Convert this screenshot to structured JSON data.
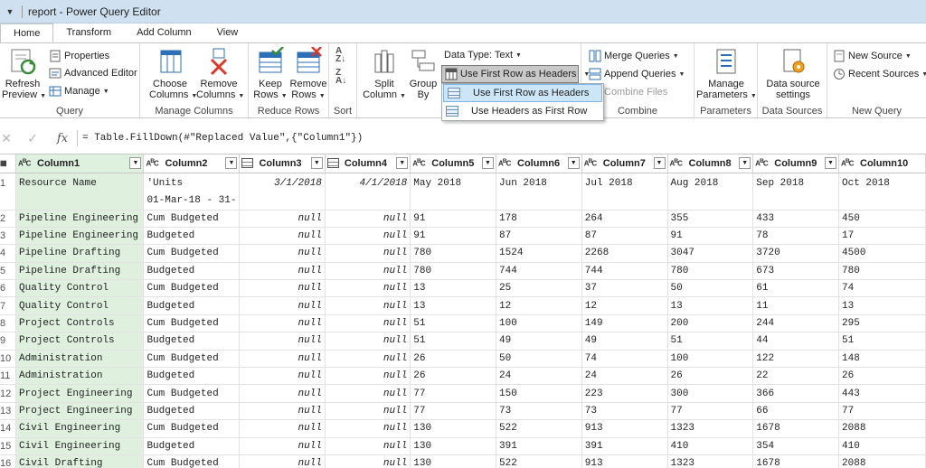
{
  "window": {
    "title": "report - Power Query Editor"
  },
  "tabs": [
    "Home",
    "Transform",
    "Add Column",
    "View"
  ],
  "ribbon": {
    "query": {
      "refresh": "Refresh",
      "preview": "Preview",
      "properties": "Properties",
      "advanced": "Advanced Editor",
      "manage": "Manage",
      "label": "Query"
    },
    "manage_columns": {
      "choose": "Choose",
      "columns1": "Columns",
      "remove": "Remove",
      "columns2": "Columns",
      "label": "Manage Columns"
    },
    "reduce_rows": {
      "keep": "Keep",
      "rows1": "Rows",
      "remove": "Remove",
      "rows2": "Rows",
      "label": "Reduce Rows"
    },
    "sort": {
      "label": "Sort"
    },
    "transform": {
      "split": "Split",
      "column": "Column",
      "group": "Group",
      "by": "By",
      "data_type": "Data Type: Text",
      "first_row": "Use First Row as Headers"
    },
    "combine": {
      "merge": "Merge Queries",
      "append": "Append Queries",
      "combine_files": "Combine Files",
      "label": "Combine"
    },
    "parameters": {
      "manage": "Manage",
      "params": "Parameters",
      "label": "Parameters"
    },
    "data_sources": {
      "ds": "Data source",
      "settings": "settings",
      "label": "Data Sources"
    },
    "new_query": {
      "new_source": "New Source",
      "recent": "Recent Sources",
      "label": "New Query"
    }
  },
  "menu": {
    "item1": "Use First Row as Headers",
    "item2": "Use Headers as First Row"
  },
  "formula": "= Table.FillDown(#\"Replaced Value\",{\"Column1\"})",
  "columns": [
    "Column1",
    "Column2",
    "Column3",
    "Column4",
    "Column5",
    "Column6",
    "Column7",
    "Column8",
    "Column9",
    "Column10"
  ],
  "header_row": {
    "rn": "1",
    "c1": "Resource Name",
    "c2a": "'Units",
    "c2b": "01-Mar-18 - 31-",
    "c3": "3/1/2018",
    "c4": "4/1/2018",
    "c5": "May  2018",
    "c6": "Jun  2018",
    "c7": "Jul  2018",
    "c8": "Aug  2018",
    "c9": "Sep  2018",
    "c10": "Oct  2018"
  },
  "rows": [
    [
      "2",
      "Pipeline Engineering",
      "Cum Budgeted",
      "null",
      "null",
      "91",
      "178",
      "264",
      "355",
      "433",
      "450"
    ],
    [
      "3",
      "Pipeline Engineering",
      "Budgeted",
      "null",
      "null",
      "91",
      "87",
      "87",
      "91",
      "78",
      "17"
    ],
    [
      "4",
      "Pipeline Drafting",
      "Cum Budgeted",
      "null",
      "null",
      "780",
      "1524",
      "2268",
      "3047",
      "3720",
      "4500"
    ],
    [
      "5",
      "Pipeline Drafting",
      "Budgeted",
      "null",
      "null",
      "780",
      "744",
      "744",
      "780",
      "673",
      "780"
    ],
    [
      "6",
      "Quality Control",
      "Cum Budgeted",
      "null",
      "null",
      "13",
      "25",
      "37",
      "50",
      "61",
      "74"
    ],
    [
      "7",
      "Quality Control",
      "Budgeted",
      "null",
      "null",
      "13",
      "12",
      "12",
      "13",
      "11",
      "13"
    ],
    [
      "8",
      "Project Controls",
      "Cum Budgeted",
      "null",
      "null",
      "51",
      "100",
      "149",
      "200",
      "244",
      "295"
    ],
    [
      "9",
      "Project Controls",
      "Budgeted",
      "null",
      "null",
      "51",
      "49",
      "49",
      "51",
      "44",
      "51"
    ],
    [
      "10",
      "Administration",
      "Cum Budgeted",
      "null",
      "null",
      "26",
      "50",
      "74",
      "100",
      "122",
      "148"
    ],
    [
      "11",
      "Administration",
      "Budgeted",
      "null",
      "null",
      "26",
      "24",
      "24",
      "26",
      "22",
      "26"
    ],
    [
      "12",
      "Project Engineering",
      "Cum Budgeted",
      "null",
      "null",
      "77",
      "150",
      "223",
      "300",
      "366",
      "443"
    ],
    [
      "13",
      "Project Engineering",
      "Budgeted",
      "null",
      "null",
      "77",
      "73",
      "73",
      "77",
      "66",
      "77"
    ],
    [
      "14",
      "Civil Engineering",
      "Cum Budgeted",
      "null",
      "null",
      "130",
      "522",
      "913",
      "1323",
      "1678",
      "2088"
    ],
    [
      "15",
      "Civil Engineering",
      "Budgeted",
      "null",
      "null",
      "130",
      "391",
      "391",
      "410",
      "354",
      "410"
    ],
    [
      "16",
      "Civil Drafting",
      "Cum Budgeted",
      "null",
      "null",
      "130",
      "522",
      "913",
      "1323",
      "1678",
      "2088"
    ]
  ]
}
